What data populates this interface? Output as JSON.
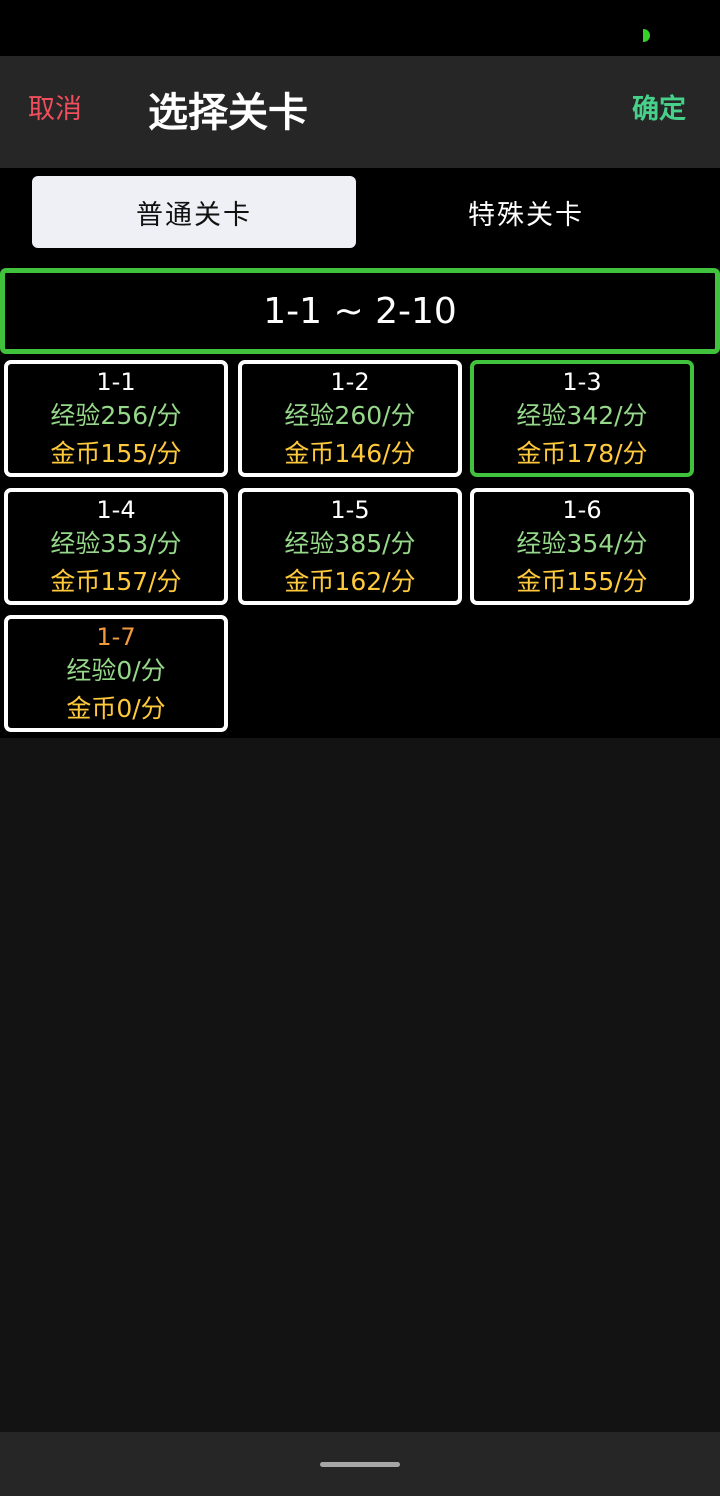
{
  "header": {
    "cancel_label": "取消",
    "title": "选择关卡",
    "confirm_label": "确定"
  },
  "tabs": [
    {
      "label": "普通关卡",
      "active": true
    },
    {
      "label": "特殊关卡",
      "active": false
    }
  ],
  "range_label": "1-1 ~ 2-10",
  "stages": [
    {
      "name": "1-1",
      "exp": "经验256/分",
      "gold": "金币155/分"
    },
    {
      "name": "1-2",
      "exp": "经验260/分",
      "gold": "金币146/分"
    },
    {
      "name": "1-3",
      "exp": "经验342/分",
      "gold": "金币178/分"
    },
    {
      "name": "1-4",
      "exp": "经验353/分",
      "gold": "金币157/分"
    },
    {
      "name": "1-5",
      "exp": "经验385/分",
      "gold": "金币162/分"
    },
    {
      "name": "1-6",
      "exp": "经验354/分",
      "gold": "金币155/分"
    },
    {
      "name": "1-7",
      "exp": "经验0/分",
      "gold": "金币0/分"
    }
  ],
  "selected_stage": "1-3",
  "colors": {
    "cancel": "#f04e5c",
    "confirm": "#46d08a",
    "selected_border": "#41c23c",
    "exp_text": "#96d88a",
    "gold_text": "#ffc93c",
    "locked_stage": "#f29a3c"
  }
}
